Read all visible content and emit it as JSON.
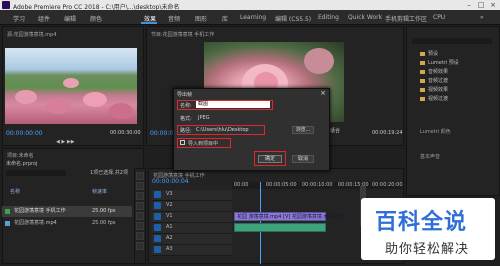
{
  "window": {
    "title": "Adobe Premiere Pro CC 2018 - C:\\用户\\...\\desktop\\未命名"
  },
  "tabs": [
    {
      "label": "学习"
    },
    {
      "label": "组件"
    },
    {
      "label": "编辑"
    },
    {
      "label": "颜色"
    },
    {
      "label": "效果"
    },
    {
      "label": "音频"
    },
    {
      "label": "图形"
    },
    {
      "label": "库"
    },
    {
      "label": "Learning"
    },
    {
      "label": "编辑 (CS5.5)"
    },
    {
      "label": "Editing"
    },
    {
      "label": "Quick Work"
    },
    {
      "label": "手机剪辑工作区"
    },
    {
      "label": "CPU"
    }
  ],
  "source_monitor": {
    "tab": "源:花园游荡意境.mp4",
    "timecode_left": "00:00:00:00",
    "timecode_right": "00:00:30:00"
  },
  "program_monitor": {
    "tab": "节目:花园游荡意境 手机工作",
    "timecode_left": "00:00:00:00",
    "fit": "适合",
    "timecode_right": "00:00:19:24"
  },
  "project_panel": {
    "tab": "项目:未命名",
    "project_file": "未命名.prproj",
    "count": "1项已选择,共2项",
    "columns": [
      "名称",
      "帧速率"
    ],
    "items": [
      {
        "name": "花园游荡意境 手机工作",
        "rate": "25.00 fps",
        "color": "#3fa34d"
      },
      {
        "name": "花园游荡意境.mp4",
        "rate": "25.00 fps",
        "color": "#5aa0d8"
      }
    ]
  },
  "timeline": {
    "tab": "花园游荡意境 手机工作",
    "timecode": "00:00:00:04",
    "ruler": [
      "00:00",
      "00:00:05:00",
      "00:00:10:00",
      "00:00:15:00",
      "00:00:20:00"
    ],
    "tracks": [
      {
        "name": "V3"
      },
      {
        "name": "V2"
      },
      {
        "name": "V1"
      },
      {
        "name": "A1"
      },
      {
        "name": "A2"
      },
      {
        "name": "A3"
      }
    ],
    "clip_label": "花园 游荡意境.mp4 [V]  花园游荡意境.mp4 [V]"
  },
  "effects_panel": {
    "items": [
      {
        "label": "预设"
      },
      {
        "label": "Lumetri 预设"
      },
      {
        "label": "音频效果"
      },
      {
        "label": "音频过渡"
      },
      {
        "label": "视频效果"
      },
      {
        "label": "视频过渡"
      }
    ],
    "lumetri_label": "Lumetri 颜色",
    "essential_label": "基本声音"
  },
  "dialog": {
    "title": "导出帧",
    "name_label": "名称:",
    "name_value": "截图",
    "format_label": "格式:",
    "format_value": "JPEG",
    "path_label": "路径:",
    "path_value": "C:\\Users\\hlu\\Desktop",
    "browse_label": "浏览...",
    "import_label": "导入到项目中",
    "ok_label": "确定",
    "cancel_label": "取消"
  },
  "watermark": {
    "line1": "百科全说",
    "line2": "助你轻松解决"
  },
  "colors": {
    "accent": "#4aa3ff",
    "highlight": "#e3262e",
    "folder": "#d1a84a"
  }
}
